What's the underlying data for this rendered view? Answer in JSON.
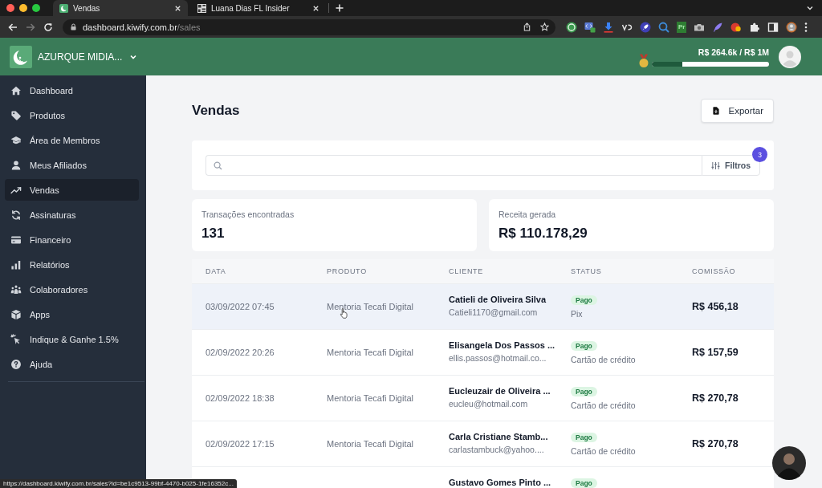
{
  "browser": {
    "tabs": [
      {
        "title": "Vendas",
        "selected": true
      },
      {
        "title": "Luana Dias FL Insider",
        "selected": false
      }
    ],
    "address": {
      "host": "dashboard.kiwify.com.br",
      "path": "/sales"
    },
    "extension_label": "Pr",
    "status_url": "https://dashboard.kiwify.com.br/sales?id=be1c9513-99bf-4470-b025-1fe16352c..."
  },
  "header": {
    "workspace": "AZURQUE MIDIA...",
    "goal": {
      "reading": "R$ 264.6k / R$ 1M",
      "level": 0.26
    }
  },
  "sidebar": {
    "items": [
      {
        "label": "Dashboard",
        "selected": false
      },
      {
        "label": "Produtos",
        "selected": false
      },
      {
        "label": "Área de Membros",
        "selected": false
      },
      {
        "label": "Meus Afiliados",
        "selected": false
      },
      {
        "label": "Vendas",
        "selected": true
      },
      {
        "label": "Assinaturas",
        "selected": false
      },
      {
        "label": "Financeiro",
        "selected": false
      },
      {
        "label": "Relatórios",
        "selected": false
      },
      {
        "label": "Colaboradores",
        "selected": false
      },
      {
        "label": "Apps",
        "selected": false
      },
      {
        "label": "Indique & Ganhe 1.5%",
        "selected": false
      },
      {
        "label": "Ajuda",
        "selected": false
      }
    ]
  },
  "page": {
    "title": "Vendas",
    "export_button": "Exportar",
    "filters": {
      "label": "Filtros",
      "count": "3"
    }
  },
  "stats": [
    {
      "label": "Transações encontradas",
      "value": "131"
    },
    {
      "label": "Receita gerada",
      "value": "R$ 110.178,29"
    }
  ],
  "table": {
    "columns": [
      "DATA",
      "PRODUTO",
      "CLIENTE",
      "STATUS",
      "COMISSÃO"
    ],
    "rows": [
      {
        "date": "03/09/2022 07:45",
        "product": "Mentoria Tecafi Digital",
        "client": "Catieli de Oliveira Silva",
        "email": "Catieli1170@gmail.com",
        "status": "Pago",
        "method": "Pix",
        "commission": "R$ 456,18",
        "highlighted": true
      },
      {
        "date": "02/09/2022 20:26",
        "product": "Mentoria Tecafi Digital",
        "client": "Elisangela Dos Passos ...",
        "email": "ellis.passos@hotmail.co...",
        "status": "Pago",
        "method": "Cartão de crédito",
        "commission": "R$ 157,59",
        "highlighted": false
      },
      {
        "date": "02/09/2022 18:38",
        "product": "Mentoria Tecafi Digital",
        "client": "Eucleuzair de Oliveira ...",
        "email": "eucleu@hotmail.com",
        "status": "Pago",
        "method": "Cartão de crédito",
        "commission": "R$ 270,78",
        "highlighted": false
      },
      {
        "date": "02/09/2022 17:15",
        "product": "Mentoria Tecafi Digital",
        "client": "Carla Cristiane Stamb...",
        "email": "carlastambuck@yahoo....",
        "status": "Pago",
        "method": "Cartão de crédito",
        "commission": "R$ 270,78",
        "highlighted": false
      },
      {
        "client": "Gustavo Gomes Pinto ...",
        "status": "Pago",
        "highlighted": false
      }
    ]
  }
}
